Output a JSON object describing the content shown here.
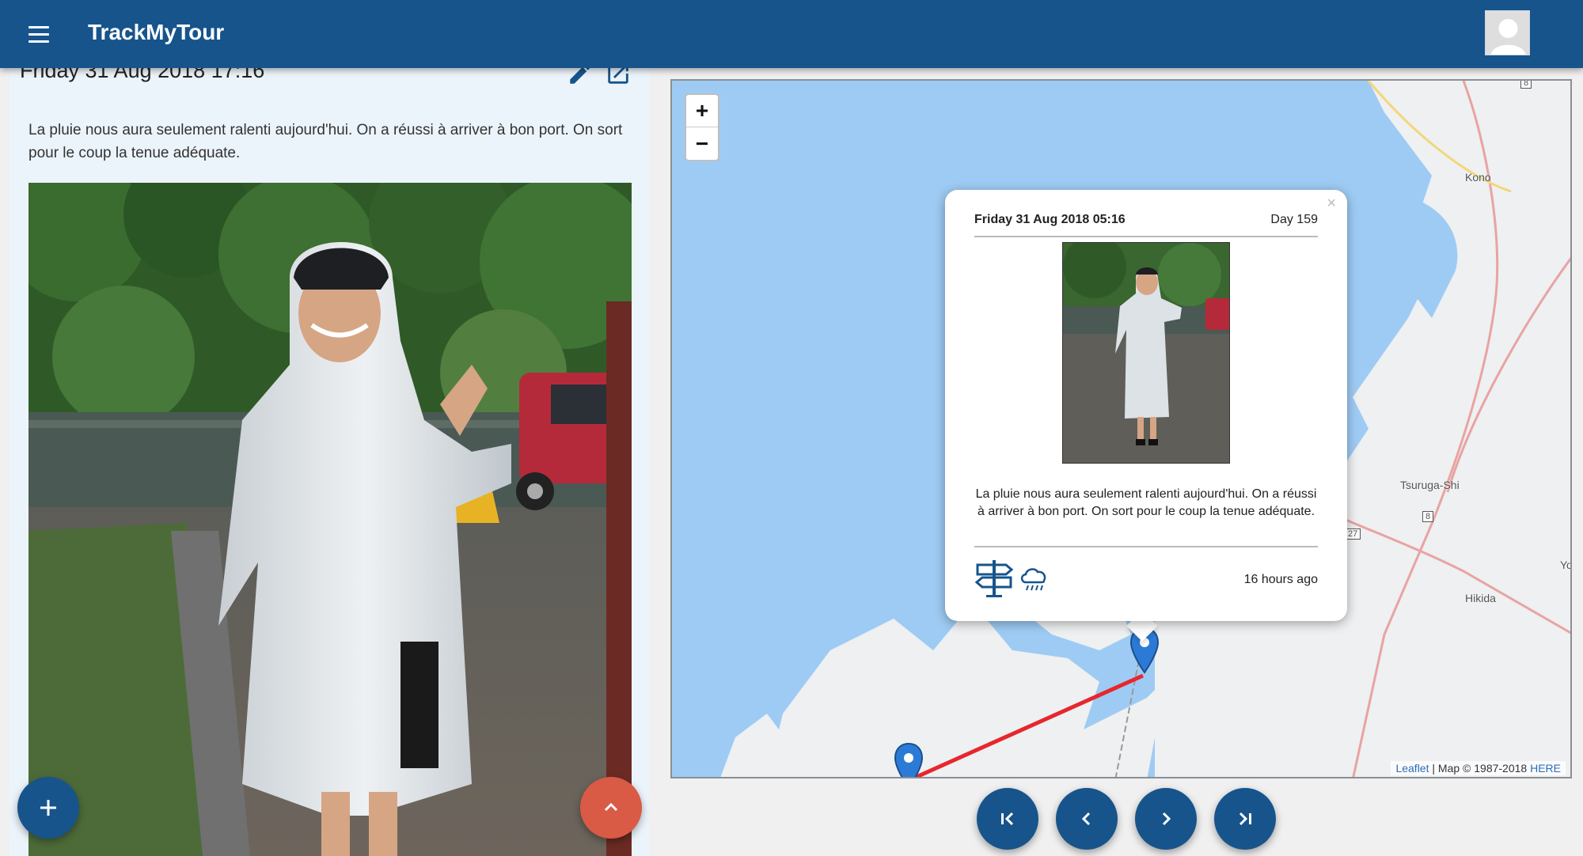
{
  "app": {
    "title": "TrackMyTour"
  },
  "header": {
    "menu_icon": "menu-icon",
    "avatar_icon": "user-avatar-icon"
  },
  "entry": {
    "date": "Friday 31 Aug 2018 17:16",
    "text": "La pluie nous aura seulement ralenti aujourd'hui. On a réussi à arriver à bon port. On sort pour le coup la tenue adéquate."
  },
  "map": {
    "zoom_in": "+",
    "zoom_out": "−",
    "attribution": {
      "leaflet": "Leaflet",
      "map": " | Map © 1987-2018 ",
      "here": "HERE"
    },
    "places": {
      "kono": "Kono",
      "tsuruga": "Tsuruga-Shi",
      "hikida": "Hikida",
      "yo": "Yo",
      "route_8a": "8",
      "route_8b": "8",
      "route_27": "27"
    },
    "popup": {
      "close": "×",
      "date": "Friday 31 Aug 2018 05:16",
      "day": "Day 159",
      "text": "La pluie nous aura seulement ralenti aujourd'hui. On a réussi à arriver à bon port. On sort pour le coup la tenue adéquate.",
      "time_ago": "16 hours ago"
    }
  },
  "colors": {
    "primary": "#17548c",
    "accent": "#d95a45",
    "route": "#e8262d",
    "water": "#9ecbf4"
  }
}
